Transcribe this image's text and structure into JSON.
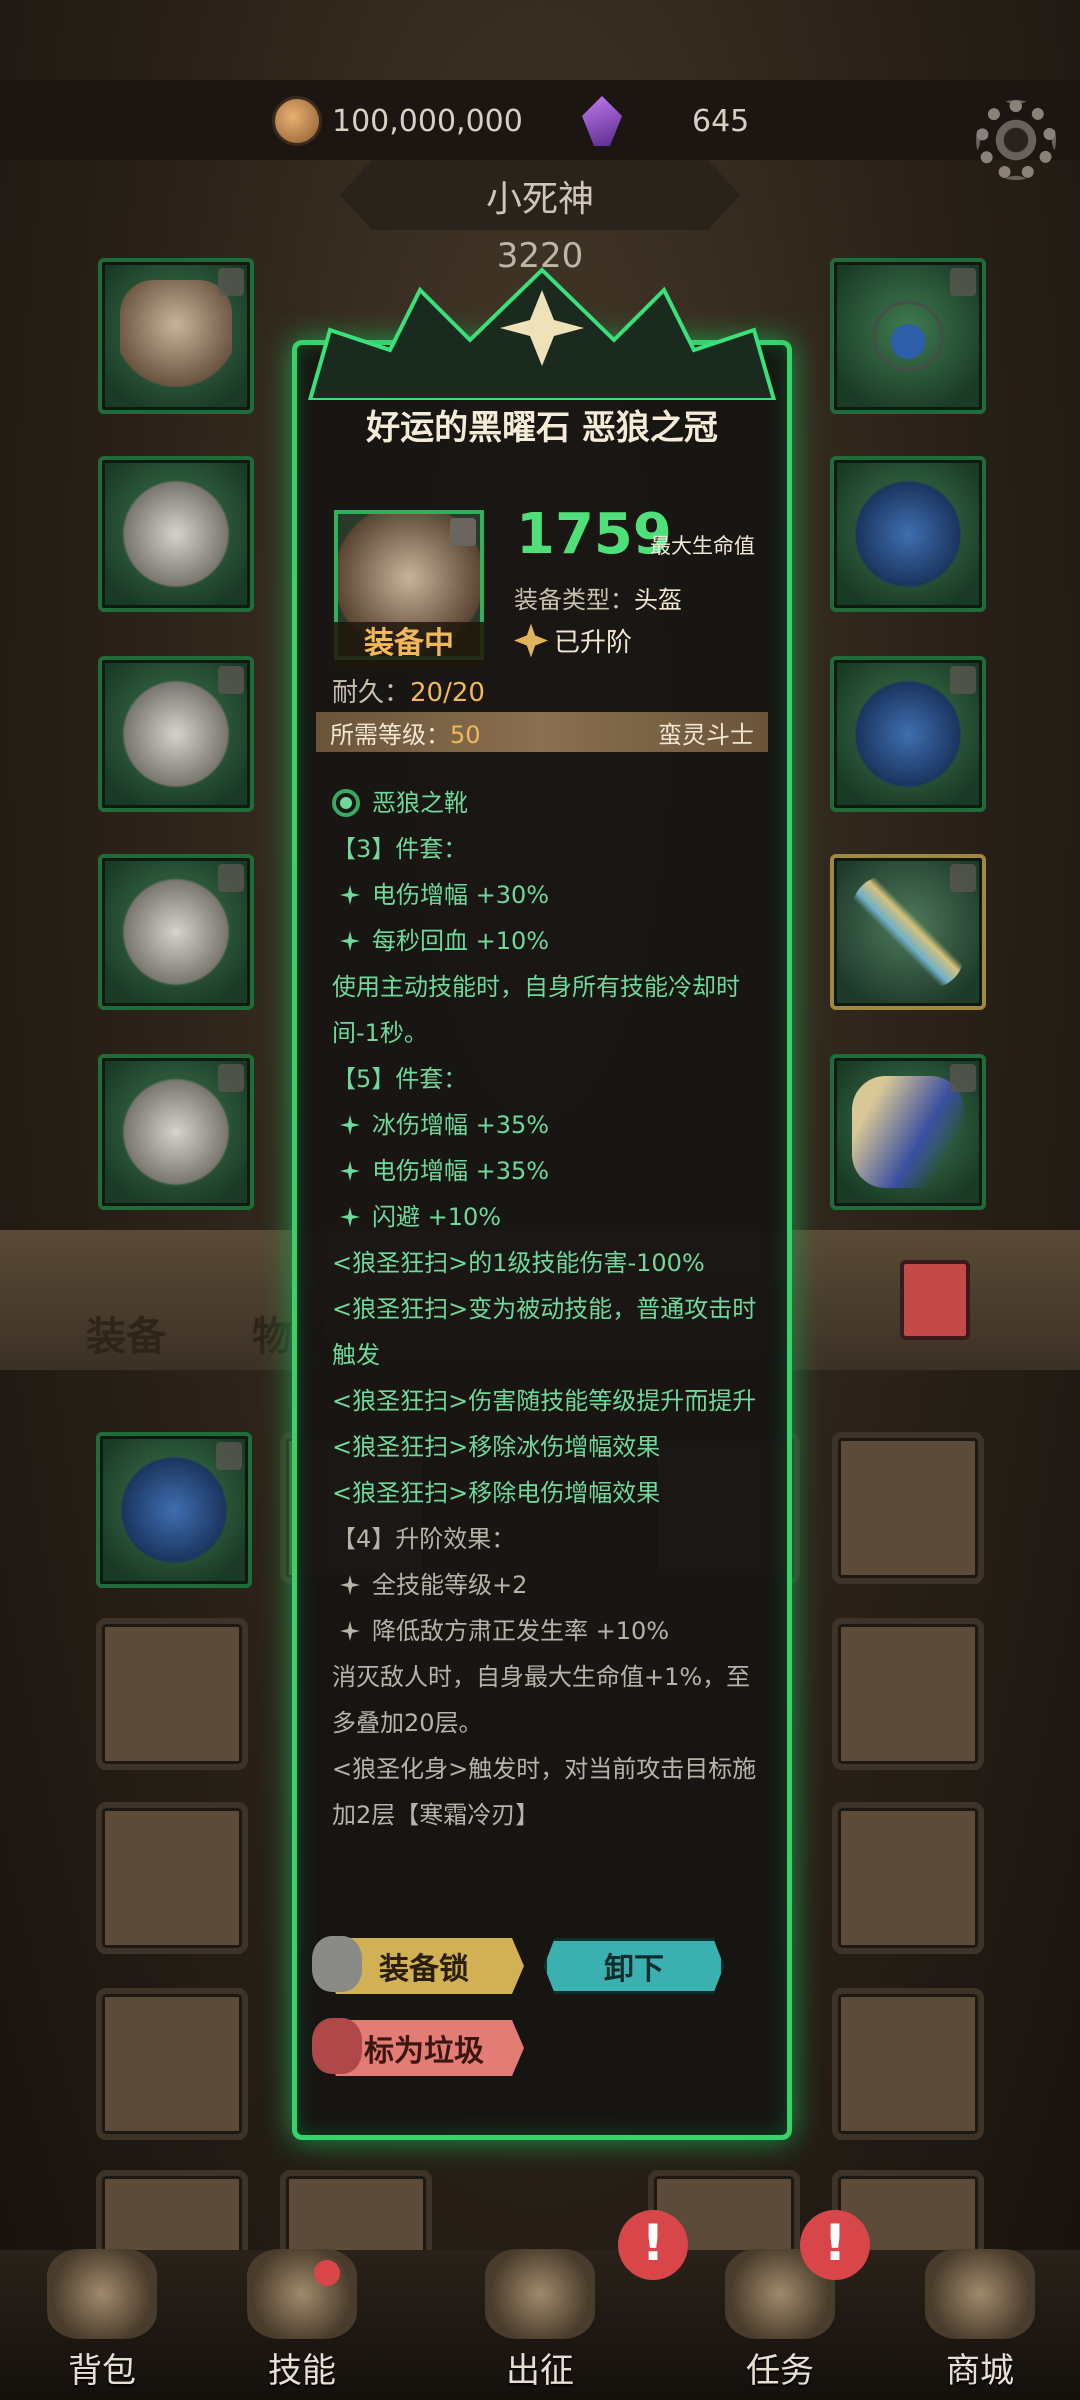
{
  "currency": {
    "gold": "100,000,000",
    "gems": "645"
  },
  "character": {
    "name": "小死神",
    "power": "3220"
  },
  "tabs": {
    "equipment": "装备",
    "items": "物品"
  },
  "item_popup": {
    "title": "好运的黑曜石 恶狼之冠",
    "stat_value": "1759",
    "stat_label": "最大生命值",
    "equipped_label": "装备中",
    "type_label": "装备类型：",
    "type_value": "头盔",
    "upgraded_label": "已升阶",
    "durability_label": "耐久：",
    "durability_value": "20/20",
    "level_req_label": "所需等级：",
    "level_req_value": "50",
    "class_req": "蛮灵斗士",
    "lines": [
      {
        "kind": "radio",
        "text": "恶狼之靴"
      },
      {
        "kind": "head",
        "text": "【3】件套："
      },
      {
        "kind": "star",
        "text": "电伤增幅 +30%"
      },
      {
        "kind": "star",
        "text": "每秒回血 +10%"
      },
      {
        "kind": "plain",
        "text": "使用主动技能时，自身所有技能冷却时间-1秒。"
      },
      {
        "kind": "head",
        "text": "【5】件套："
      },
      {
        "kind": "star",
        "text": "冰伤增幅 +35%"
      },
      {
        "kind": "star",
        "text": "电伤增幅 +35%"
      },
      {
        "kind": "star",
        "text": "闪避 +10%"
      },
      {
        "kind": "plain",
        "text": "<狼圣狂扫>的1级技能伤害-100%"
      },
      {
        "kind": "plain",
        "text": "<狼圣狂扫>变为被动技能，普通攻击时触发"
      },
      {
        "kind": "plain",
        "text": "<狼圣狂扫>伤害随技能等级提升而提升"
      },
      {
        "kind": "plain",
        "text": "<狼圣狂扫>移除冰伤增幅效果"
      },
      {
        "kind": "plain",
        "text": "<狼圣狂扫>移除电伤增幅效果"
      },
      {
        "kind": "ghead",
        "text": "【4】升阶效果："
      },
      {
        "kind": "gstar",
        "text": "全技能等级+2"
      },
      {
        "kind": "gstar",
        "text": "降低敌方肃正发生率 +10%"
      },
      {
        "kind": "gplain",
        "text": "消灭敌人时，自身最大生命值+1%，至多叠加20层。"
      },
      {
        "kind": "gplain",
        "text": "<狼圣化身>触发时，对当前攻击目标施加2层【寒霜冷刃】"
      }
    ],
    "buttons": {
      "lock": "装备锁",
      "unequip": "卸下",
      "junk": "标为垃圾"
    }
  },
  "nav": {
    "bag": "背包",
    "skills": "技能",
    "expedition": "出征",
    "tasks": "任务",
    "shop": "商城"
  },
  "alerts": {
    "tasks": "!",
    "expedition": "!"
  }
}
